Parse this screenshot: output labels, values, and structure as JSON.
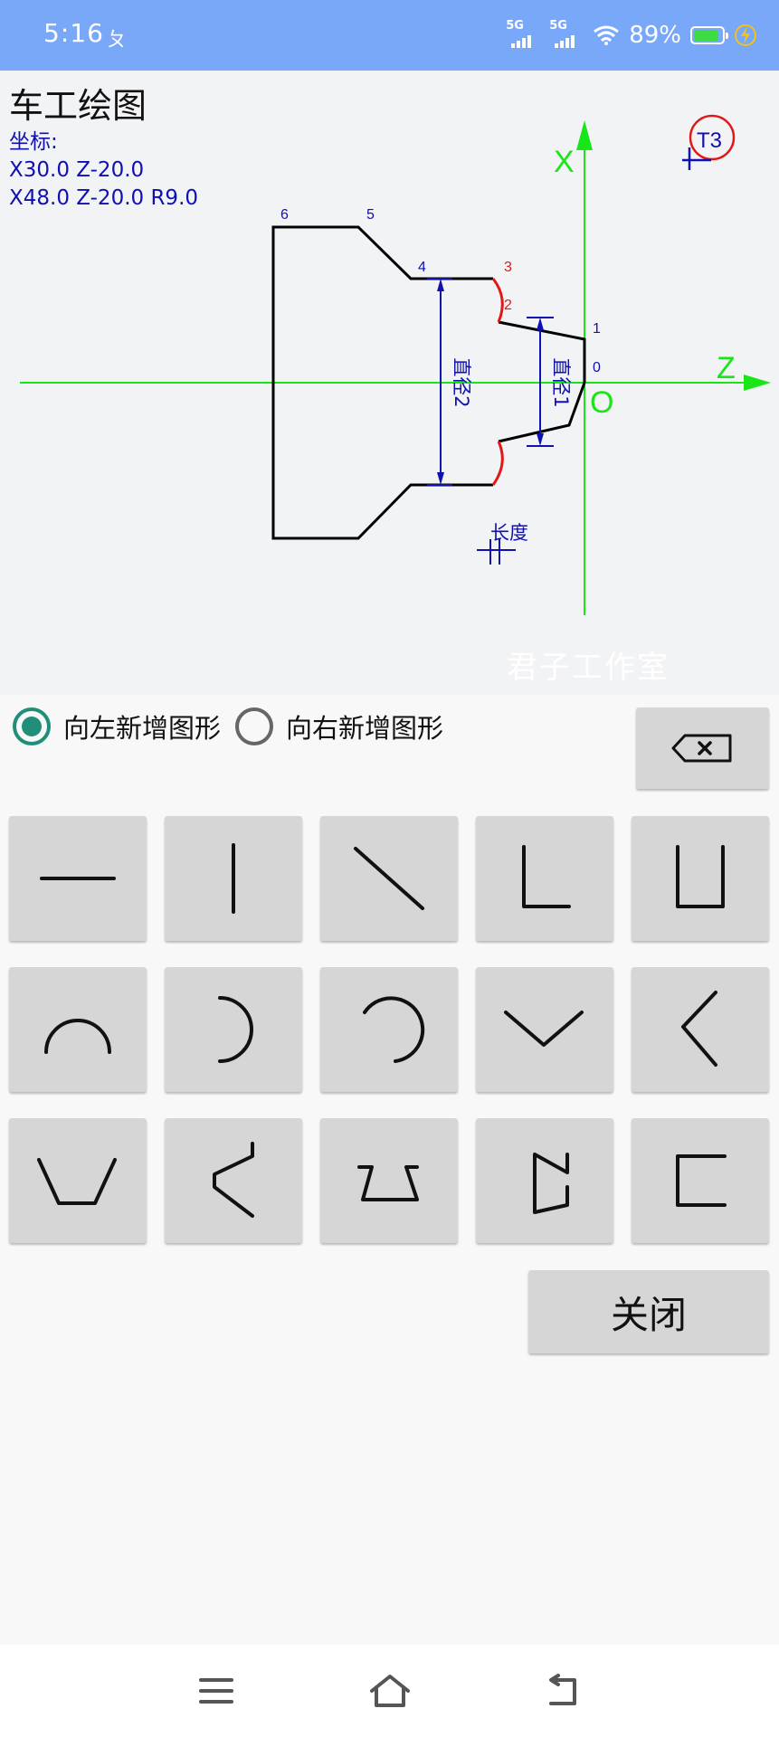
{
  "status_bar": {
    "time": "5:16",
    "extra_glyph": "ㄆ",
    "network1": "5G",
    "network2": "5G",
    "battery_text": "89%",
    "battery_level": 0.89,
    "battery_color": "#3ddc45",
    "icons": [
      "signal-5g-icon",
      "signal-5g-icon",
      "wifi-icon",
      "battery-icon",
      "charging-bolt-icon"
    ]
  },
  "app": {
    "title": "车工绘图",
    "coords_label": "坐标:",
    "coords_lines": [
      "X30.0 Z-20.0",
      "X48.0 Z-20.0 R9.0"
    ]
  },
  "drawing": {
    "axis_x_label": "X",
    "axis_z_label": "Z",
    "origin_label": "O",
    "tool_label": "T3",
    "point_labels": [
      "0",
      "1",
      "2",
      "3",
      "4",
      "5",
      "6"
    ],
    "dim_diameter1": "直径1",
    "dim_diameter2": "直径2",
    "dim_length": "长度",
    "watermark": "君子工作室",
    "colors": {
      "axis": "#19e619",
      "profile": "#000000",
      "highlight": "#e01818",
      "dimension": "#1010b0"
    }
  },
  "controls": {
    "radio_left": "向左新增图形",
    "radio_right": "向右新增图形",
    "selected": "left",
    "accent": "#1f8f7a",
    "backspace_icon": "backspace-icon",
    "close_label": "关闭"
  },
  "shapes": [
    "horizontal-line-icon",
    "vertical-line-icon",
    "diagonal-line-icon",
    "l-corner-icon",
    "u-shape-icon",
    "arc-top-icon",
    "arc-right-icon",
    "arc-right-hook-icon",
    "v-shape-icon",
    "chevron-left-icon",
    "trapezoid-down-icon",
    "bracket-angle-icon",
    "trapezoid-up-icon",
    "zigzag-icon",
    "bracket-open-icon"
  ],
  "nav": {
    "icons": [
      "menu-icon",
      "home-icon",
      "back-icon"
    ]
  }
}
